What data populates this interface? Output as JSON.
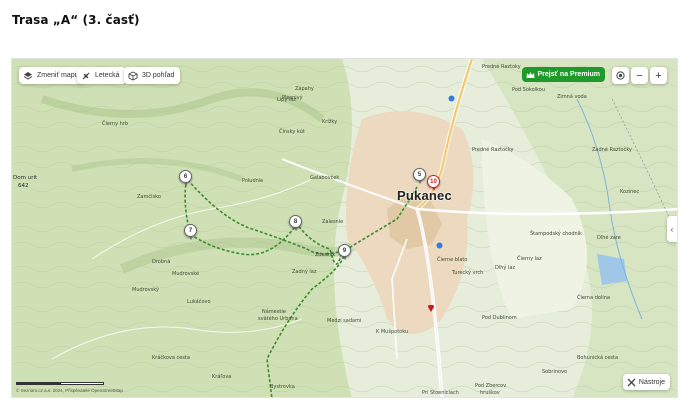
{
  "title": "Trasa „A“ (3. časť)",
  "controls": {
    "change_map": "Zmeniť mapu",
    "aerial": "Letecká",
    "view_3d": "3D pohľad",
    "premium": "Prejsť na Premium",
    "zoom_out": "−",
    "zoom_in": "+",
    "tools": "Nástroje",
    "side_toggle": "‹"
  },
  "map": {
    "town": "Pukanec",
    "markers": [
      "5",
      "6",
      "7",
      "8",
      "9",
      "10"
    ],
    "labels": {
      "jurt_hill": "Dom urit",
      "jurt_alt": "642",
      "prednie_raztoky": "Predné Raztoky",
      "pod_sokolkou": "Pod Sokolkou",
      "zimna_voda": "Zimná voda",
      "predna_raztocky": "Predné Raztočky",
      "zadna_raztocky": "Zadné Raztočky",
      "kozinec": "Kozinec",
      "diely_zare": "Dlhé zare",
      "stampodsky_chodnik": "Štampodský chodník",
      "cierny_laz": "Čierny laz",
      "cierne_blato": "Čierne blato",
      "turecky_vrch": "Turecký vrch",
      "diely_laz": "Dlhý laz",
      "cierna_dolina": "Čierna dolina",
      "mudrovsky_lom": "Mudrovský",
      "mudrovske": "Mudrovské",
      "namestie": "Námestie",
      "svateho_urbana": "svätého Urbana",
      "medzi_sekcie": "Medzi sadami",
      "k_muspotoku": "K Mušpotoku",
      "pod_zbercov": "Pod Zbercov",
      "hrudkov": "hruškov",
      "pri_stoeniciach": "Pri Stoeniciach",
      "bohunicka_cesta": "Bohunická cesta",
      "zapahy": "Zápahy",
      "plesnivy": "Plesnivý",
      "krizky": "Krížky",
      "galabovcek": "Galabovček",
      "poludnie": "Poludnie",
      "zalesnie": "Zalesnie",
      "zdudnik": "Zdudník",
      "zadny_laz": "Zadný laz",
      "zamcisko": "Zamčisko",
      "drobna": "Drobná",
      "lukacovo": "Lukáčovo",
      "bystrovka": "Bystrovka",
      "kralova": "Kráľova",
      "sobrinovo": "Sobrinovo",
      "cinsky_kut": "Čínsky kút",
      "cerny_hrib": "Čierny hrb",
      "pod_dublinom": "Pod Dublinom",
      "krackova_cesta": "Kráčkova cesta",
      "lipy_laz": "Lipy laz"
    },
    "attribution": "© Seznam.cz a.s. 2024, Přispěvatelé OpenStreetMap",
    "colors": {
      "forest": "#c9dcae",
      "meadow": "#e6eedb",
      "town": "#ecd9bf",
      "route": "#3c8a2e",
      "marker_red": "#c81e1e",
      "premium": "#1e9a2b"
    }
  }
}
